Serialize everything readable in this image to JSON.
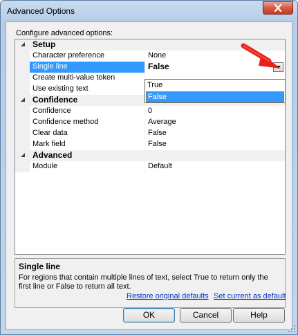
{
  "window": {
    "title": "Advanced Options"
  },
  "header_label": "Configure advanced options:",
  "grid": {
    "categories": [
      {
        "name": "Setup",
        "rows": [
          {
            "name": "Character preference",
            "value": "None"
          },
          {
            "name": "Single line",
            "value": "False"
          },
          {
            "name": "Create multi-value token",
            "value": ""
          },
          {
            "name": "Use existing text",
            "value": ""
          }
        ]
      },
      {
        "name": "Confidence",
        "rows": [
          {
            "name": "Confidence",
            "value": "0"
          },
          {
            "name": "Confidence method",
            "value": "Average"
          },
          {
            "name": "Clear data",
            "value": "False"
          },
          {
            "name": "Mark field",
            "value": "False"
          }
        ]
      },
      {
        "name": "Advanced",
        "rows": [
          {
            "name": "Module",
            "value": "Default"
          }
        ]
      }
    ],
    "dropdown_options": [
      "True",
      "False"
    ],
    "dropdown_selected": "False"
  },
  "description": {
    "title": "Single line",
    "text": "For regions that contain multiple lines of text, select True to return only the first line or False to return all text."
  },
  "links": {
    "restore": "Restore original defaults",
    "set_default": "Set current as default"
  },
  "buttons": {
    "ok": "OK",
    "cancel": "Cancel",
    "help": "Help"
  },
  "colors": {
    "selection": "#3399ff",
    "link": "#0033cc",
    "arrow": "#e8201a",
    "close_button": "#c9412a"
  }
}
